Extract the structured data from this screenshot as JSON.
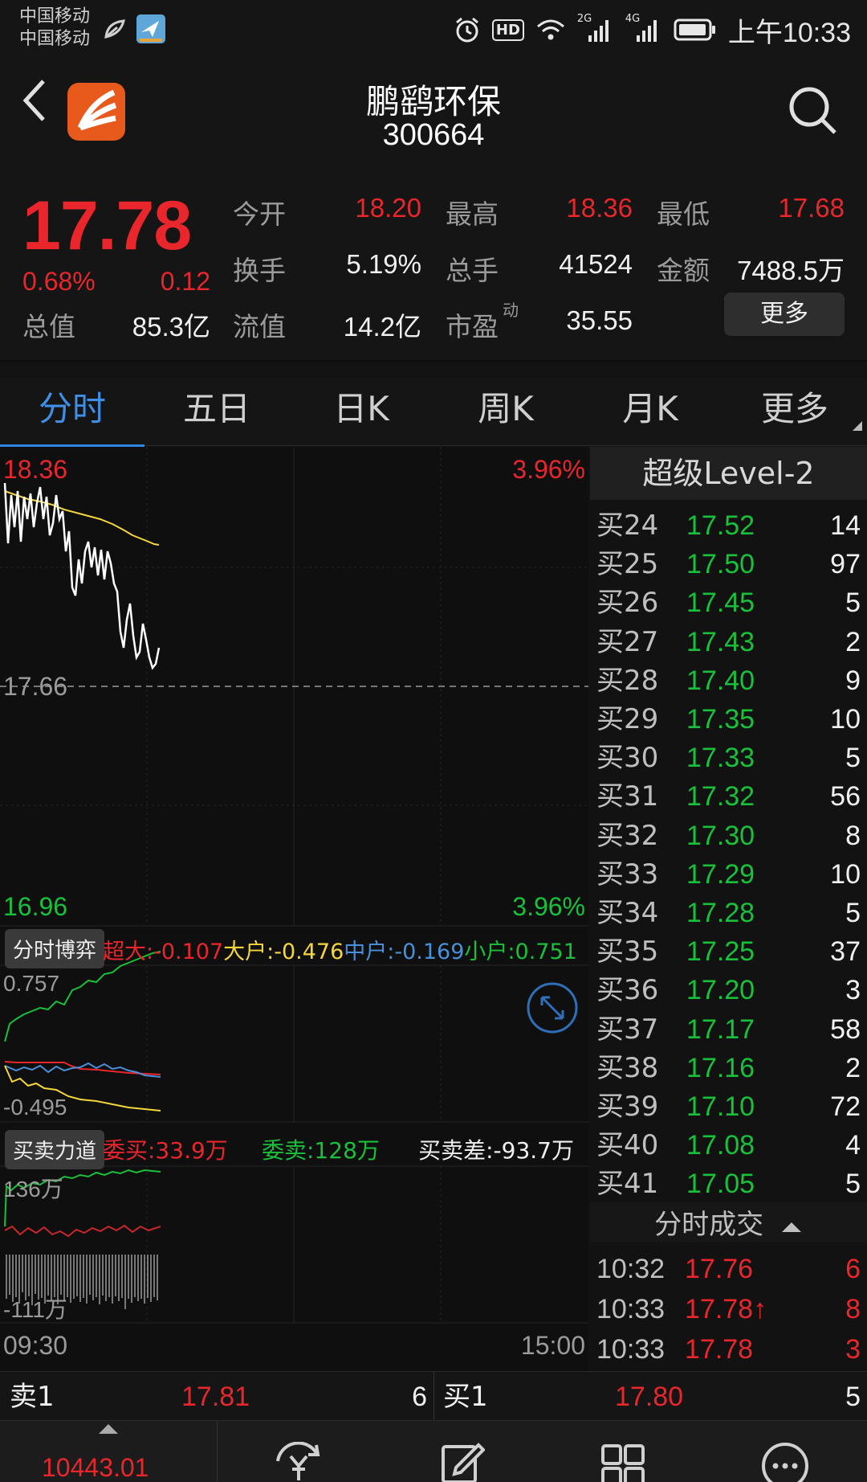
{
  "status_bar": {
    "carrier1": "中国移动",
    "carrier2": "中国移动",
    "net1": "2G",
    "net2": "4G",
    "hd": "HD",
    "time": "上午10:33"
  },
  "header": {
    "name": "鹏鹞环保",
    "code": "300664"
  },
  "quote": {
    "price": "17.78",
    "change_pct": "0.68%",
    "change": "0.12",
    "open_label": "今开",
    "open": "18.20",
    "high_label": "最高",
    "high": "18.36",
    "low_label": "最低",
    "low": "17.68",
    "turnover_label": "换手",
    "turnover": "5.19%",
    "volume_label": "总手",
    "volume": "41524",
    "amount_label": "金额",
    "amount": "7488.5万",
    "mktcap_label": "总值",
    "mktcap": "85.3亿",
    "float_label": "流值",
    "float": "14.2亿",
    "pe_label": "市盈",
    "pe_sup": "动",
    "pe": "35.55",
    "more_button": "更多"
  },
  "tabs": [
    "分时",
    "五日",
    "日K",
    "周K",
    "月K",
    "更多"
  ],
  "chart": {
    "top_price": "18.36",
    "top_pct": "3.96%",
    "mid_price": "17.66",
    "bottom_price": "16.96",
    "bottom_pct": "3.96%",
    "game_button": "分时博弈",
    "super_large": "超大:-0.107",
    "large": "大户:-0.476",
    "medium": "中户:-0.169",
    "small": "小户:0.751",
    "game_top": "0.757",
    "game_bottom": "-0.495",
    "force_button": "买卖力道",
    "bid_total": "委买:33.9万",
    "ask_total": "委卖:128万",
    "diff": "买卖差:-93.7万",
    "force_top": "136万",
    "force_bottom": "-111万",
    "time_start": "09:30",
    "time_end": "15:00",
    "colors": {
      "price_line": "#ffffff",
      "avg_line": "#f5d63b",
      "up": "#e8262b",
      "down": "#19c13a"
    }
  },
  "level2": {
    "title": "超级Level-2",
    "bids": [
      {
        "label": "买24",
        "price": "17.52",
        "vol": "14"
      },
      {
        "label": "买25",
        "price": "17.50",
        "vol": "97"
      },
      {
        "label": "买26",
        "price": "17.45",
        "vol": "5"
      },
      {
        "label": "买27",
        "price": "17.43",
        "vol": "2"
      },
      {
        "label": "买28",
        "price": "17.40",
        "vol": "9"
      },
      {
        "label": "买29",
        "price": "17.35",
        "vol": "10"
      },
      {
        "label": "买30",
        "price": "17.33",
        "vol": "5"
      },
      {
        "label": "买31",
        "price": "17.32",
        "vol": "56"
      },
      {
        "label": "买32",
        "price": "17.30",
        "vol": "8"
      },
      {
        "label": "买33",
        "price": "17.29",
        "vol": "10"
      },
      {
        "label": "买34",
        "price": "17.28",
        "vol": "5"
      },
      {
        "label": "买35",
        "price": "17.25",
        "vol": "37"
      },
      {
        "label": "买36",
        "price": "17.20",
        "vol": "3"
      },
      {
        "label": "买37",
        "price": "17.17",
        "vol": "58"
      },
      {
        "label": "买38",
        "price": "17.16",
        "vol": "2"
      },
      {
        "label": "买39",
        "price": "17.10",
        "vol": "72"
      },
      {
        "label": "买40",
        "price": "17.08",
        "vol": "4"
      },
      {
        "label": "买41",
        "price": "17.05",
        "vol": "5"
      }
    ],
    "trades_title": "分时成交",
    "trades": [
      {
        "time": "10:32",
        "price": "17.76",
        "vol": "6"
      },
      {
        "time": "10:33",
        "price": "17.78↑",
        "vol": "8"
      },
      {
        "time": "10:33",
        "price": "17.78",
        "vol": "3"
      }
    ]
  },
  "bidask": {
    "sell1_label": "卖1",
    "sell1_price": "17.81",
    "sell1_vol": "6",
    "buy1_label": "买1",
    "buy1_price": "17.80",
    "buy1_vol": "5"
  },
  "nav": {
    "index_value": "10443.01"
  }
}
